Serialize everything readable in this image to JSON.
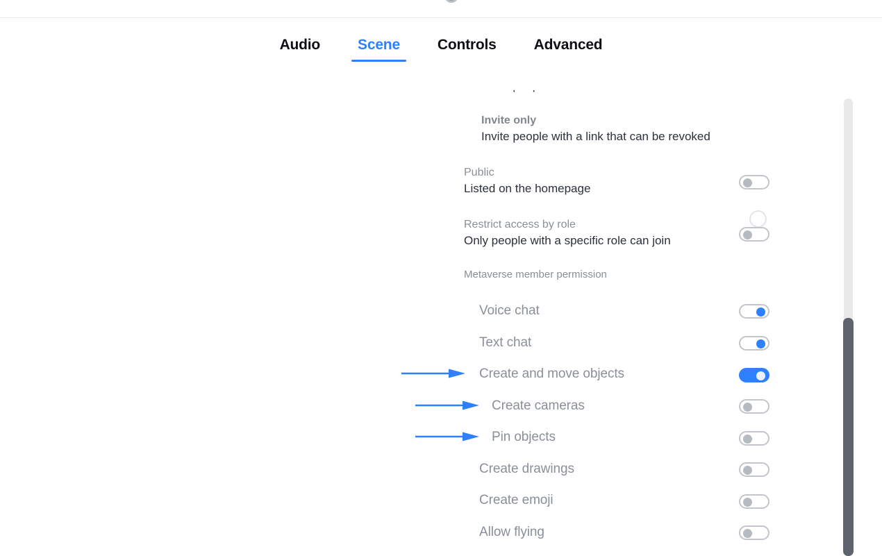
{
  "header": {
    "clipped_top_icon": "avatar-circle-icon"
  },
  "tabs": [
    {
      "label": "Audio",
      "active": false
    },
    {
      "label": "Scene",
      "active": true
    },
    {
      "label": "Controls",
      "active": false
    },
    {
      "label": "Advanced",
      "active": false
    }
  ],
  "colors": {
    "accent": "#2f80ff",
    "label_gray": "#8a8f98",
    "desc_dark": "#2b303a",
    "toggle_off_border": "#c2c5cb",
    "toggle_off_knob": "#b6bac1",
    "scrollbar_thumb": "#5d646e",
    "scrollbar_track": "#e8e8e9"
  },
  "access_modes": [
    {
      "title": "Invite only",
      "description": "Invite people with a link that can be revoked",
      "control": "radio",
      "selected": false,
      "bold_title": true
    },
    {
      "title": "Public",
      "description": "Listed on the homepage",
      "control": "toggle",
      "state": "off",
      "bold_title": false
    },
    {
      "title": "Restrict access by role",
      "description": "Only people with a specific role can join",
      "control": "toggle",
      "state": "off",
      "bold_title": false
    }
  ],
  "permissions": {
    "section_label": "Metaverse member permission",
    "items": [
      {
        "label": "Voice chat",
        "state": "on"
      },
      {
        "label": "Text chat",
        "state": "on"
      },
      {
        "label": "Create and move objects",
        "state": "on-full"
      },
      {
        "label": "Create cameras",
        "state": "off"
      },
      {
        "label": "Pin objects",
        "state": "off"
      },
      {
        "label": "Create drawings",
        "state": "off"
      },
      {
        "label": "Create emoji",
        "state": "off"
      },
      {
        "label": "Allow flying",
        "state": "off"
      }
    ]
  },
  "annotations": {
    "arrow_color": "#2f80ff",
    "arrows": [
      {
        "target": "Create and move objects"
      },
      {
        "target": "Create cameras"
      },
      {
        "target": "Pin objects"
      }
    ]
  },
  "scrollbar": {
    "orientation": "vertical",
    "thumb_position_label": "scrolled-down"
  }
}
